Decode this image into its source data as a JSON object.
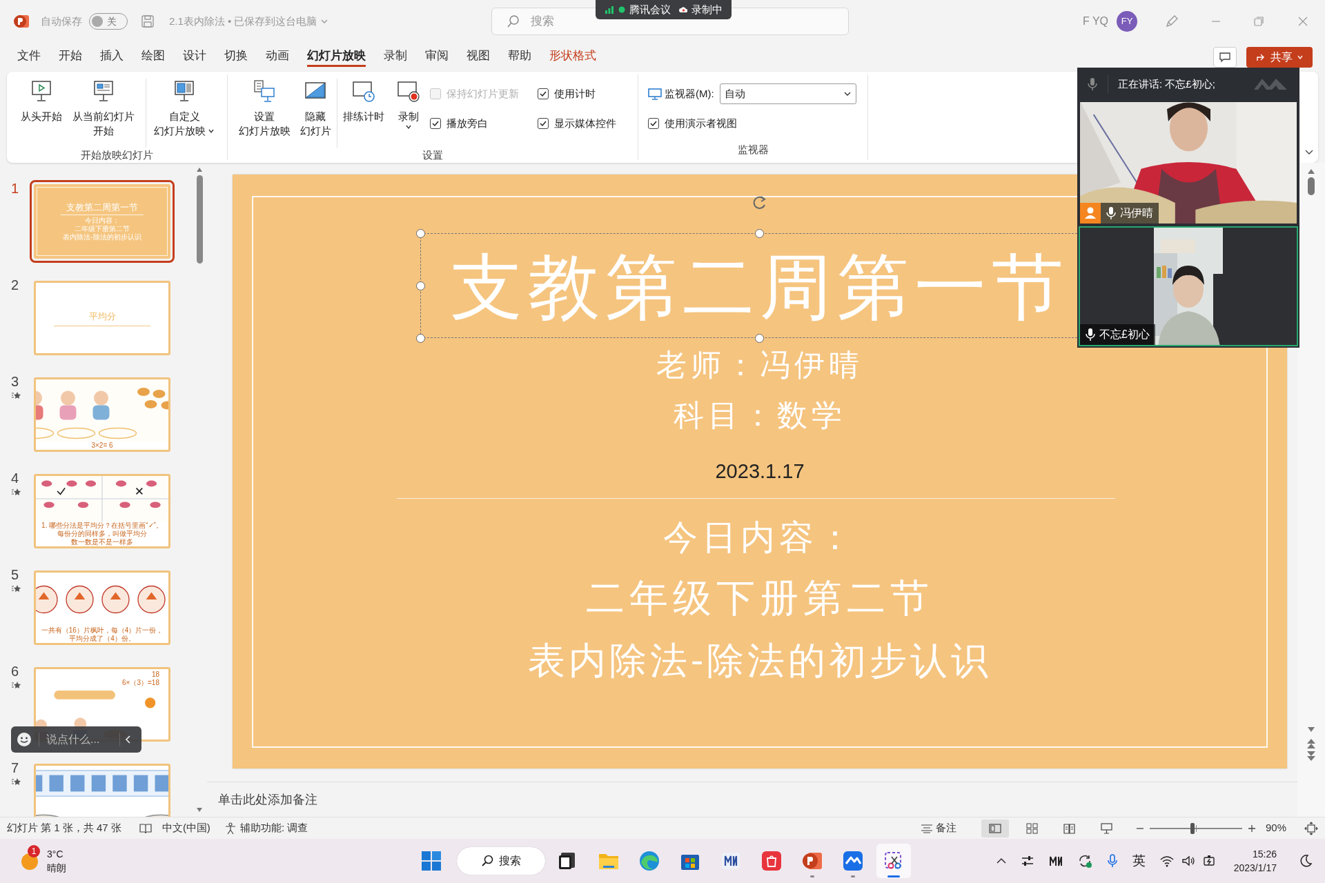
{
  "title_bar": {
    "autosave": {
      "label": "自动保存",
      "state_label": "关",
      "on": false
    },
    "document_title": "2.1表内除法 • 已保存到这台电脑",
    "search": {
      "placeholder": "搜索"
    },
    "user": {
      "name": "F YQ",
      "initials": "FY"
    }
  },
  "meeting_badge": {
    "app_name": "腾讯会议",
    "recording": "录制中"
  },
  "menu_tabs": [
    {
      "label": "文件",
      "selected": false,
      "contextual": false
    },
    {
      "label": "开始",
      "selected": false,
      "contextual": false
    },
    {
      "label": "插入",
      "selected": false,
      "contextual": false
    },
    {
      "label": "绘图",
      "selected": false,
      "contextual": false
    },
    {
      "label": "设计",
      "selected": false,
      "contextual": false
    },
    {
      "label": "切换",
      "selected": false,
      "contextual": false
    },
    {
      "label": "动画",
      "selected": false,
      "contextual": false
    },
    {
      "label": "幻灯片放映",
      "selected": true,
      "contextual": false
    },
    {
      "label": "录制",
      "selected": false,
      "contextual": false
    },
    {
      "label": "审阅",
      "selected": false,
      "contextual": false
    },
    {
      "label": "视图",
      "selected": false,
      "contextual": false
    },
    {
      "label": "帮助",
      "selected": false,
      "contextual": false
    },
    {
      "label": "形状格式",
      "selected": false,
      "contextual": true
    }
  ],
  "share_button": "共享",
  "ribbon": {
    "groups": [
      {
        "label": "开始放映幻灯片",
        "buttons": [
          {
            "lines": [
              "从头开始"
            ],
            "dropdown": false
          },
          {
            "lines": [
              "从当前幻灯片",
              "开始"
            ],
            "dropdown": false
          },
          {
            "lines": [
              "自定义",
              "幻灯片放映"
            ],
            "dropdown": true
          }
        ]
      },
      {
        "label": "设置",
        "buttons": [
          {
            "lines": [
              "设置",
              "幻灯片放映"
            ],
            "dropdown": false
          },
          {
            "lines": [
              "隐藏",
              "幻灯片"
            ],
            "dropdown": false
          },
          {
            "lines": [
              "排练计时"
            ],
            "dropdown": false
          },
          {
            "lines": [
              "录制"
            ],
            "dropdown": true
          }
        ],
        "checkboxes": [
          {
            "label": "保持幻灯片更新",
            "checked": false,
            "disabled": true
          },
          {
            "label": "使用计时",
            "checked": true,
            "disabled": false
          },
          {
            "label": "播放旁白",
            "checked": true,
            "disabled": false
          },
          {
            "label": "显示媒体控件",
            "checked": true,
            "disabled": false
          }
        ]
      },
      {
        "label": "监视器",
        "monitor": {
          "label": "监视器(M):",
          "value": "自动"
        },
        "checkboxes": [
          {
            "label": "使用演示者视图",
            "checked": true,
            "disabled": false
          }
        ]
      }
    ]
  },
  "thumbnails": [
    {
      "number": "1",
      "selected": true,
      "animated": false,
      "kind": "title",
      "texts": [
        "支教第二周第一节",
        "今日内容：",
        "二年级下册第二节",
        "表内除法-除法的初步认识"
      ]
    },
    {
      "number": "2",
      "selected": false,
      "animated": false,
      "kind": "section",
      "texts": [
        "平均分"
      ]
    },
    {
      "number": "3",
      "selected": false,
      "animated": true,
      "kind": "illustration",
      "texts": [
        "3×2= 6"
      ]
    },
    {
      "number": "4",
      "selected": false,
      "animated": true,
      "kind": "illustration",
      "texts": [
        "1. 哪些分法是平均分？在括号里画“✓”。",
        "每份分的同样多，叫做平均分",
        "数一数是不是一样多"
      ]
    },
    {
      "number": "5",
      "selected": false,
      "animated": true,
      "kind": "illustration",
      "texts": [
        "一共有（16）片枫叶，每（4）片一份，平均分成了（4）份。"
      ]
    },
    {
      "number": "6",
      "selected": false,
      "animated": true,
      "kind": "illustration",
      "texts": [
        "18",
        "6×（3）=18"
      ]
    },
    {
      "number": "7",
      "selected": false,
      "animated": true,
      "kind": "illustration"
    }
  ],
  "chat_input": {
    "placeholder": "说点什么..."
  },
  "slide": {
    "title": "支教第二周第一节",
    "title_selected": true,
    "teacher": "老师：冯伊晴",
    "subject": "科目：数学",
    "date": "2023.1.17",
    "heading": "今日内容：",
    "lines": [
      "二年级下册第二节",
      "表内除法-除法的初步认识"
    ]
  },
  "notes": {
    "placeholder": "单击此处添加备注"
  },
  "meeting_panel": {
    "speaking": "正在讲话: 不忘£初心;",
    "participants": [
      {
        "name": "冯伊晴",
        "host": true,
        "highlighted": false
      },
      {
        "name": "不忘£初心",
        "host": false,
        "highlighted": true
      }
    ]
  },
  "status_bar": {
    "slide_info": "幻灯片 第 1 张，共 47 张",
    "language": "中文(中国)",
    "accessibility": "辅助功能: 调查",
    "notes_button": "备注",
    "view_buttons": [
      {
        "selected": true
      },
      {
        "selected": false
      },
      {
        "selected": false
      },
      {
        "selected": false
      }
    ],
    "zoom": {
      "level": 0.46,
      "value": "90%"
    }
  },
  "taskbar": {
    "weather": {
      "badge": "1",
      "temperature": "3°C",
      "condition": "晴朗"
    },
    "search": "搜索",
    "apps": [
      {
        "running": false,
        "active": false
      },
      {
        "running": false,
        "active": false
      },
      {
        "running": false,
        "active": false
      },
      {
        "running": false,
        "active": false
      },
      {
        "running": false,
        "active": false
      },
      {
        "running": false,
        "active": false
      },
      {
        "running": true,
        "active": false
      },
      {
        "running": true,
        "active": false
      },
      {
        "running": false,
        "active": true
      }
    ],
    "ime": "英",
    "time": "15:26",
    "date": "2023/1/17"
  }
}
